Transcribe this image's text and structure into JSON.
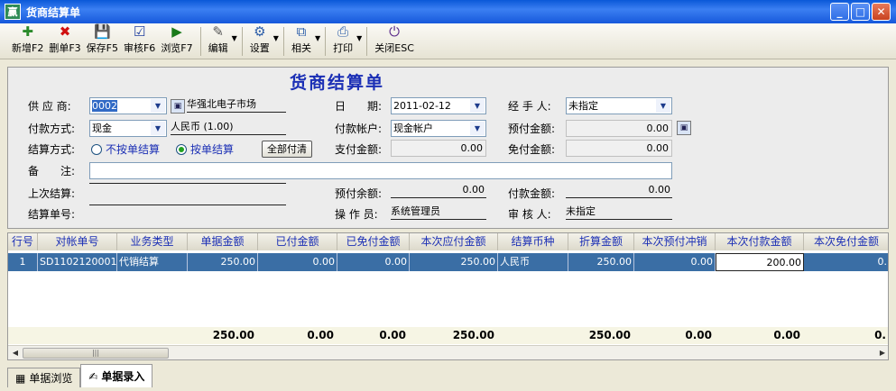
{
  "window": {
    "title": "货商结算单",
    "app_icon": "赢"
  },
  "toolbar": [
    {
      "label": "新增F2",
      "icon": "✚"
    },
    {
      "label": "删单F3",
      "icon": "✖"
    },
    {
      "label": "保存F5",
      "icon": "💾"
    },
    {
      "label": "审核F6",
      "icon": "☑"
    },
    {
      "label": "浏览F7",
      "icon": "▶"
    },
    {
      "label": "编辑",
      "icon": "✎"
    },
    {
      "label": "设置",
      "icon": "⚙"
    },
    {
      "label": "相关",
      "icon": "⧉"
    },
    {
      "label": "打印",
      "icon": "⎙"
    },
    {
      "label": "关闭ESC",
      "icon": "⏻"
    }
  ],
  "form": {
    "title": "货商结算单",
    "supplier_label": "供 应 商:",
    "supplier_code": "0002",
    "supplier_name": "华强北电子市场",
    "date_label": "日　　期:",
    "date_value": "2011-02-12",
    "handler_label": "经 手 人:",
    "handler_value": "未指定",
    "paymethod_label": "付款方式:",
    "paymethod_value": "现金",
    "currency_value": "人民币 (1.00)",
    "payaccount_label": "付款帐户:",
    "payaccount_value": "现金帐户",
    "prepaid_label": "预付金额:",
    "prepaid_value": "0.00",
    "settlemode_label": "结算方式:",
    "radio_not_by_doc": "不按单结算",
    "radio_by_doc": "按单结算",
    "payall_button": "全部付清",
    "paid_amount_label": "支付金额:",
    "paid_amount_value": "0.00",
    "waived_label": "免付金额:",
    "waived_value": "0.00",
    "remark_label": "备　　注:",
    "remark_value": "",
    "last_settle_label": "上次结算:",
    "last_settle_value": "",
    "prepaid_balance_label": "预付余额:",
    "prepaid_balance_value": "0.00",
    "payment_amount_label": "付款金额:",
    "payment_amount_value": "0.00",
    "settle_no_label": "结算单号:",
    "settle_no_value": "",
    "operator_label": "操 作 员:",
    "operator_value": "系统管理员",
    "auditor_label": "审 核 人:",
    "auditor_value": "未指定"
  },
  "grid": {
    "columns": [
      "行号",
      "对帐单号",
      "业务类型",
      "单据金额",
      "已付金额",
      "已免付金额",
      "本次应付金额",
      "结算币种",
      "折算金额",
      "本次预付冲销",
      "本次付款金额",
      "本次免付金额"
    ],
    "rows": [
      [
        "1",
        "SD1102120001",
        "代销结算",
        "250.00",
        "0.00",
        "0.00",
        "250.00",
        "人民币",
        "250.00",
        "0.00",
        "200.00",
        "0."
      ]
    ],
    "totals": [
      "",
      "",
      "",
      "250.00",
      "0.00",
      "0.00",
      "250.00",
      "",
      "250.00",
      "0.00",
      "0.00",
      "0."
    ]
  },
  "tabs": [
    {
      "label": "单据浏览",
      "icon": "▦"
    },
    {
      "label": "单据录入",
      "icon": "✍"
    }
  ]
}
